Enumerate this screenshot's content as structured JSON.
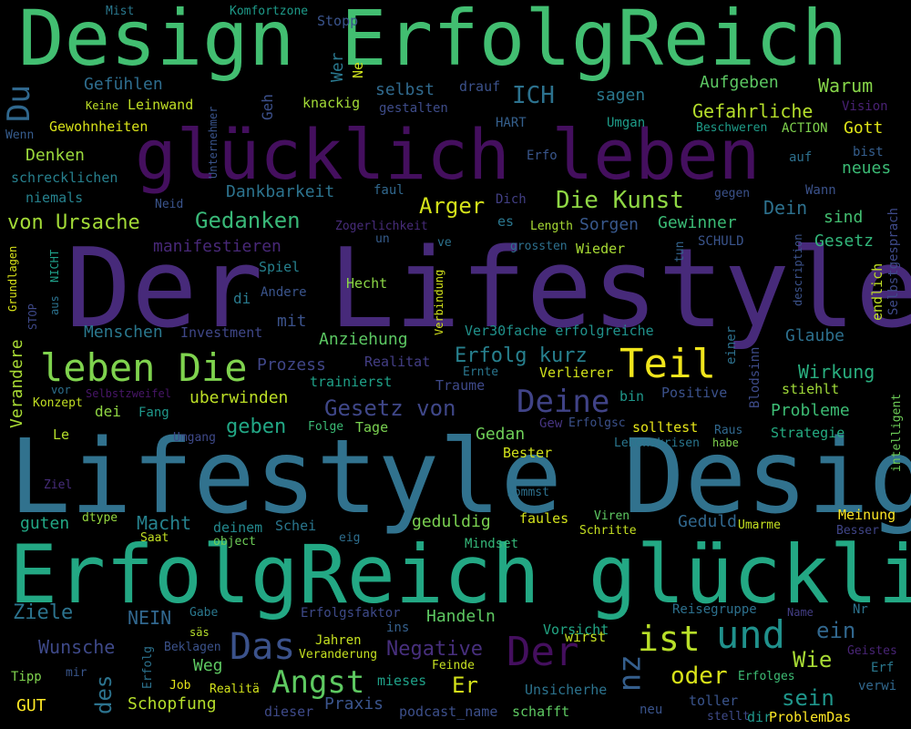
{
  "words": [
    {
      "t": "Der Lifestyle",
      "c": "#472a7a"
    },
    {
      "t": "Lifestyle Design",
      "c": "#31728e"
    },
    {
      "t": "ErfolgReich glücklich",
      "c": "#23a884"
    },
    {
      "t": "Design ErfolgReich",
      "c": "#42be71"
    },
    {
      "t": "glücklich leben",
      "c": "#440f5e"
    },
    {
      "t": "Teil",
      "c": "#f0e51c"
    },
    {
      "t": "leben Die",
      "c": "#7fd34e"
    },
    {
      "t": "Das",
      "c": "#3b528b"
    },
    {
      "t": "Der",
      "c": "#440f5e"
    },
    {
      "t": "ist",
      "c": "#b8de29"
    },
    {
      "t": "und",
      "c": "#20918c"
    },
    {
      "t": "Deine",
      "c": "#404387"
    },
    {
      "t": "Angst",
      "c": "#5ec961"
    },
    {
      "t": "Du",
      "c": "#30688e"
    },
    {
      "t": "zu",
      "c": "#355f8d"
    },
    {
      "t": "ICH",
      "c": "#2c728e"
    },
    {
      "t": "Die Kunst",
      "c": "#8fd744"
    },
    {
      "t": "oder",
      "c": "#d8e219"
    },
    {
      "t": "Gedanken",
      "c": "#39b878"
    },
    {
      "t": "Gesetz von",
      "c": "#3f4788"
    },
    {
      "t": "von Ursache",
      "c": "#a2da37"
    },
    {
      "t": "Erfolg kurz",
      "c": "#27808e"
    },
    {
      "t": "Arger",
      "c": "#d4e21a"
    },
    {
      "t": "Er",
      "c": "#d4e21a"
    },
    {
      "t": "Wie",
      "c": "#a8db34"
    },
    {
      "t": "sein",
      "c": "#1f968b"
    },
    {
      "t": "ein",
      "c": "#31678e"
    },
    {
      "t": "des",
      "c": "#2c738e"
    },
    {
      "t": "geben",
      "c": "#22a785"
    },
    {
      "t": "Macht",
      "c": "#26828e"
    },
    {
      "t": "Ziele",
      "c": "#2c738e"
    },
    {
      "t": "Negative",
      "c": "#472f7d"
    },
    {
      "t": "Gefühlen",
      "c": "#2e6d8e"
    },
    {
      "t": "Aufgeben",
      "c": "#5cc863"
    },
    {
      "t": "Warum",
      "c": "#86d549"
    },
    {
      "t": "Gefahrliche",
      "c": "#b5de2b"
    },
    {
      "t": "Dein",
      "c": "#2d718e"
    },
    {
      "t": "Gott",
      "c": "#dde318"
    },
    {
      "t": "Wunsche",
      "c": "#3e4989"
    },
    {
      "t": "NEIN",
      "c": "#31678e"
    },
    {
      "t": "Denken",
      "c": "#9bd93c"
    },
    {
      "t": "Dankbarkeit",
      "c": "#2c738e"
    },
    {
      "t": "Sorgen",
      "c": "#38588c"
    },
    {
      "t": "Gewinner",
      "c": "#3bbb75"
    },
    {
      "t": "Menschen",
      "c": "#2a788e"
    },
    {
      "t": "manifestieren",
      "c": "#482878"
    },
    {
      "t": "selbst",
      "c": "#306a8e"
    },
    {
      "t": "sagen",
      "c": "#2a788e"
    },
    {
      "t": "Schopfung",
      "c": "#b5de2b"
    },
    {
      "t": "Praxis",
      "c": "#3a548c"
    },
    {
      "t": "Wirkung",
      "c": "#29af7f"
    },
    {
      "t": "Probleme",
      "c": "#3dbc74"
    },
    {
      "t": "Glaube",
      "c": "#2d708e"
    },
    {
      "t": "geduldig",
      "c": "#7ad151"
    },
    {
      "t": "Geduld",
      "c": "#31688e"
    },
    {
      "t": "Handeln",
      "c": "#5ec962"
    },
    {
      "t": "Prozess",
      "c": "#404688"
    },
    {
      "t": "Anziehung",
      "c": "#5cc863"
    },
    {
      "t": "uberwinden",
      "c": "#bddf26"
    },
    {
      "t": "Gedan",
      "c": "#6ece58"
    },
    {
      "t": "Weg",
      "c": "#5ec962"
    },
    {
      "t": "GUT",
      "c": "#fde725"
    },
    {
      "t": "guten",
      "c": "#22a785"
    },
    {
      "t": "Wer",
      "c": "#2a788e"
    },
    {
      "t": "Geh",
      "c": "#3c508b"
    },
    {
      "t": "mit",
      "c": "#3b528b"
    },
    {
      "t": "Gesetz",
      "c": "#32b67a"
    },
    {
      "t": "sind",
      "c": "#43bf71"
    },
    {
      "t": "neues",
      "c": "#3bbb75"
    },
    {
      "t": "Verandere",
      "c": "#a8db34"
    },
    {
      "t": "knackig",
      "c": "#a2da37"
    },
    {
      "t": "drauf",
      "c": "#3b518b"
    },
    {
      "t": "Leinwand",
      "c": "#c0df25"
    },
    {
      "t": "Gewohnheiten",
      "c": "#d8e219"
    },
    {
      "t": "schrecklichen",
      "c": "#27808e"
    },
    {
      "t": "niemals",
      "c": "#26828e"
    },
    {
      "t": "Spiel",
      "c": "#26818e"
    },
    {
      "t": "Hecht",
      "c": "#8bd646"
    },
    {
      "t": "di",
      "c": "#297a8e"
    },
    {
      "t": "Ver30fache erfolgreiche",
      "c": "#20928c"
    },
    {
      "t": "Traume",
      "c": "#3e4989"
    },
    {
      "t": "trainierst",
      "c": "#1fa188"
    },
    {
      "t": "Strategie",
      "c": "#25ac82"
    },
    {
      "t": "stiehlt",
      "c": "#a0da39"
    },
    {
      "t": "Verlierer",
      "c": "#d2e21b"
    },
    {
      "t": "endlich",
      "c": "#c0df25"
    },
    {
      "t": "Bester",
      "c": "#d2e21b"
    },
    {
      "t": "Tage",
      "c": "#7ad151"
    },
    {
      "t": "solltest",
      "c": "#e5e419"
    },
    {
      "t": "faules",
      "c": "#d2e21b"
    },
    {
      "t": "Mindset",
      "c": "#35b779"
    },
    {
      "t": "Meinung",
      "c": "#fde725"
    },
    {
      "t": "Schei",
      "c": "#2a768e"
    },
    {
      "t": "deinem",
      "c": "#23898e"
    },
    {
      "t": "mieses",
      "c": "#1fa088"
    },
    {
      "t": "Unsicherhe",
      "c": "#2c738e"
    },
    {
      "t": "wirst",
      "c": "#c5e021"
    },
    {
      "t": "Vorsicht",
      "c": "#22a785"
    },
    {
      "t": "tun",
      "c": "#33638d"
    },
    {
      "t": "dei",
      "c": "#90d743"
    },
    {
      "t": "es",
      "c": "#2a768e"
    },
    {
      "t": "faul",
      "c": "#31688e"
    },
    {
      "t": "Umgan",
      "c": "#1e9c89"
    },
    {
      "t": "gestalten",
      "c": "#3e4c8a"
    },
    {
      "t": "HART",
      "c": "#35608d"
    },
    {
      "t": "ACTION",
      "c": "#7fd34e"
    },
    {
      "t": "Beschweren",
      "c": "#1e9c89"
    },
    {
      "t": "Vision",
      "c": "#482173"
    },
    {
      "t": "bist",
      "c": "#355e8d"
    },
    {
      "t": "auf",
      "c": "#2d708e"
    },
    {
      "t": "Erfo",
      "c": "#39568c"
    },
    {
      "t": "Wann",
      "c": "#3b528b"
    },
    {
      "t": "gegen",
      "c": "#3b528b"
    },
    {
      "t": "Selbstgesprach",
      "c": "#3e4a89"
    },
    {
      "t": "Unternehmer",
      "c": "#3a548c"
    },
    {
      "t": "Dich",
      "c": "#423f85"
    },
    {
      "t": "Length",
      "c": "#a8db34"
    },
    {
      "t": "Zogerlichkeit",
      "c": "#472c7a"
    },
    {
      "t": "un",
      "c": "#365d8d"
    },
    {
      "t": "ve",
      "c": "#2c728e"
    },
    {
      "t": "grossten",
      "c": "#2d708e"
    },
    {
      "t": "Wieder",
      "c": "#a8db34"
    },
    {
      "t": "SCHULD",
      "c": "#3a548c"
    },
    {
      "t": "description",
      "c": "#3b528b"
    },
    {
      "t": "Neid",
      "c": "#3a548c"
    },
    {
      "t": "Andere",
      "c": "#3a548c"
    },
    {
      "t": "Investment",
      "c": "#3f4788"
    },
    {
      "t": "Verbindung",
      "c": "#d2e21b"
    },
    {
      "t": "Realitat",
      "c": "#433e85"
    },
    {
      "t": "Ernte",
      "c": "#2a768e"
    },
    {
      "t": "bin",
      "c": "#1f988b"
    },
    {
      "t": "Positive",
      "c": "#3b518b"
    },
    {
      "t": "Blodsinn",
      "c": "#3e4c8a"
    },
    {
      "t": "einer",
      "c": "#2d718e"
    },
    {
      "t": "intelligent",
      "c": "#6ece58"
    },
    {
      "t": "Fang",
      "c": "#1f988b"
    },
    {
      "t": "Selbstzweifel",
      "c": "#481668"
    },
    {
      "t": "vor",
      "c": "#2d708e"
    },
    {
      "t": "Konzept",
      "c": "#c2df23"
    },
    {
      "t": "Folge",
      "c": "#3bbb75"
    },
    {
      "t": "Umgang",
      "c": "#3e4989"
    },
    {
      "t": "Le",
      "c": "#b5de2b"
    },
    {
      "t": "Gew",
      "c": "#463480"
    },
    {
      "t": "Erfolgsc",
      "c": "#3b518b"
    },
    {
      "t": "Lebenskrisen",
      "c": "#2a768e"
    },
    {
      "t": "Raus",
      "c": "#31688e"
    },
    {
      "t": "Ziel",
      "c": "#472d7b"
    },
    {
      "t": "kommst",
      "c": "#2d718e"
    },
    {
      "t": "dtype",
      "c": "#95d840"
    },
    {
      "t": "Saat",
      "c": "#c2df23"
    },
    {
      "t": "object",
      "c": "#6ece58"
    },
    {
      "t": "eig",
      "c": "#2e6e8e"
    },
    {
      "t": "Viren",
      "c": "#5ec962"
    },
    {
      "t": "Schritte",
      "c": "#c5e021"
    },
    {
      "t": "Umarme",
      "c": "#c5e021"
    },
    {
      "t": "Besser",
      "c": "#404588"
    },
    {
      "t": "Gabe",
      "c": "#2a788e"
    },
    {
      "t": "Erfolgsfaktor",
      "c": "#3e4a89"
    },
    {
      "t": "sӓs",
      "c": "#b5de2b"
    },
    {
      "t": "Beklagen",
      "c": "#3b528b"
    },
    {
      "t": "Erfolg",
      "c": "#2c728e"
    },
    {
      "t": "Jahren",
      "c": "#c5e021"
    },
    {
      "t": "Veranderung",
      "c": "#c5e021"
    },
    {
      "t": "ins",
      "c": "#35608d"
    },
    {
      "t": "Reisegruppe",
      "c": "#2d718e"
    },
    {
      "t": "Name",
      "c": "#433e85"
    },
    {
      "t": "Nr",
      "c": "#2c738e"
    },
    {
      "t": "Geistes",
      "c": "#482475"
    },
    {
      "t": "Erf",
      "c": "#2a788e"
    },
    {
      "t": "Erfolges",
      "c": "#3dbc74"
    },
    {
      "t": "verwi",
      "c": "#31688e"
    },
    {
      "t": "Tipp",
      "c": "#7fd34e"
    },
    {
      "t": "mir",
      "c": "#39568c"
    },
    {
      "t": "Job",
      "c": "#e5e419"
    },
    {
      "t": "Realitӓ",
      "c": "#d2e21b"
    },
    {
      "t": "Feinde",
      "c": "#c5e021"
    },
    {
      "t": "dieser",
      "c": "#3e4a89"
    },
    {
      "t": "podcast_name",
      "c": "#3c4f8a"
    },
    {
      "t": "schafft",
      "c": "#5ec962"
    },
    {
      "t": "neu",
      "c": "#3a548c"
    },
    {
      "t": "toller",
      "c": "#3a548c"
    },
    {
      "t": "dir",
      "c": "#1f988b"
    },
    {
      "t": "stellt",
      "c": "#3e4a89"
    },
    {
      "t": "ProblemDas",
      "c": "#fde725"
    },
    {
      "t": "Mist",
      "c": "#2a788e"
    },
    {
      "t": "Komfortzone",
      "c": "#1e9b8a"
    },
    {
      "t": "Stopp",
      "c": "#3a548c"
    },
    {
      "t": "Ne",
      "c": "#cde11d"
    },
    {
      "t": "Keine",
      "c": "#bddf26"
    },
    {
      "t": "Wenn",
      "c": "#365c8d"
    },
    {
      "t": "habe",
      "c": "#7fd34e"
    },
    {
      "t": "Grundlagen",
      "c": "#d8e219"
    },
    {
      "t": "aus",
      "c": "#2c728e"
    },
    {
      "t": "NICHT",
      "c": "#1f9f88"
    },
    {
      "t": "STOP",
      "c": "#3e4989"
    }
  ]
}
